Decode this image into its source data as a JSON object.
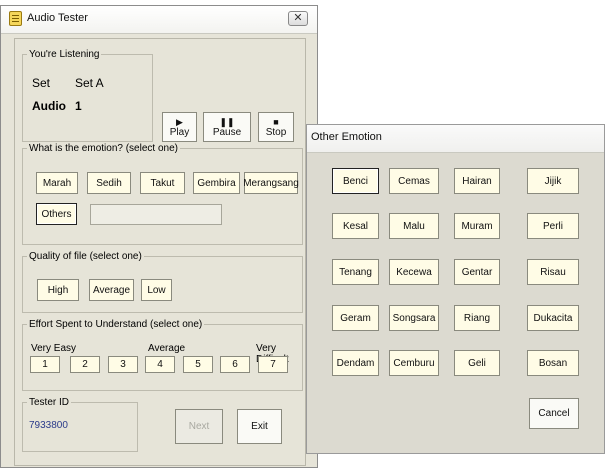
{
  "main_window": {
    "title": "Audio Tester",
    "close_glyph": "✕"
  },
  "listening": {
    "legend": "You're Listening",
    "set_label": "Set",
    "set_value": "Set A",
    "audio_label": "Audio",
    "audio_value": "1"
  },
  "media": {
    "play_label": "Play",
    "pause_label": "Pause",
    "stop_label": "Stop",
    "play_icon": "▶",
    "pause_icon": "❚❚",
    "stop_icon": "■"
  },
  "emotion": {
    "legend": "What is the emotion? (select one)",
    "buttons": [
      "Marah",
      "Sedih",
      "Takut",
      "Gembira",
      "Merangsang"
    ],
    "others_label": "Others",
    "others_value": ""
  },
  "quality": {
    "legend": "Quality of file (select one)",
    "buttons": [
      "High",
      "Average",
      "Low"
    ]
  },
  "effort": {
    "legend": "Effort Spent to Understand (select one)",
    "scale_left": "Very Easy",
    "scale_mid": "Average",
    "scale_right": "Very Difficult",
    "buttons": [
      "1",
      "2",
      "3",
      "4",
      "5",
      "6",
      "7"
    ]
  },
  "tester": {
    "legend": "Tester ID",
    "id": "7933800"
  },
  "footer": {
    "next_label": "Next",
    "exit_label": "Exit"
  },
  "popup": {
    "title": "Other Emotion",
    "rows": [
      [
        "Benci",
        "Cemas",
        "Hairan",
        "Jijik"
      ],
      [
        "Kesal",
        "Malu",
        "Muram",
        "Perli"
      ],
      [
        "Tenang",
        "Kecewa",
        "Gentar",
        "Risau"
      ],
      [
        "Geram",
        "Songsara",
        "Riang",
        "Dukacita"
      ],
      [
        "Dendam",
        "Cemburu",
        "Geli",
        "Bosan"
      ]
    ],
    "cancel_label": "Cancel"
  }
}
